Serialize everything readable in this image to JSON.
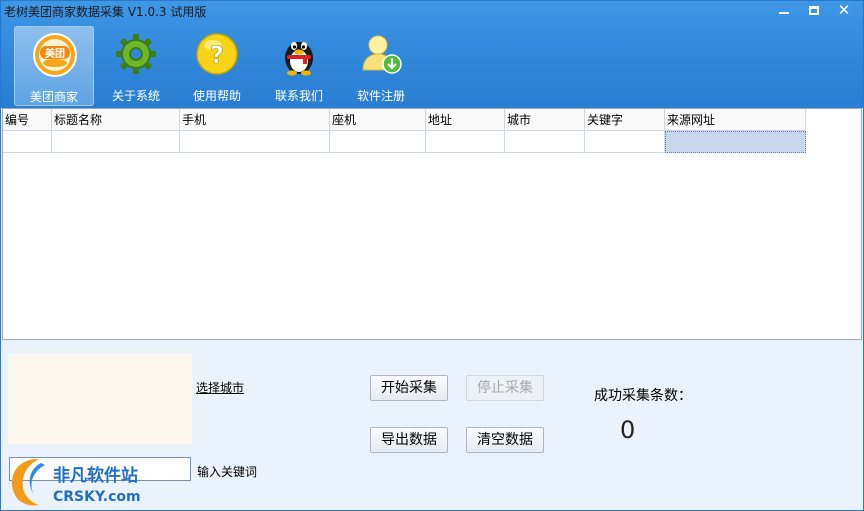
{
  "app": {
    "title": "老树美团商家数据采集 V1.0.3 试用版"
  },
  "window_controls": {
    "minimize": "minimize",
    "maximize": "maximize",
    "close": "close"
  },
  "toolbar": [
    {
      "label": "美团商家",
      "icon": "meituan-logo-icon",
      "badge": "美团"
    },
    {
      "label": "关于系统",
      "icon": "gear-icon"
    },
    {
      "label": "使用帮助",
      "icon": "help-icon",
      "glyph": "?"
    },
    {
      "label": "联系我们",
      "icon": "qq-penguin-icon"
    },
    {
      "label": "软件注册",
      "icon": "user-register-icon"
    }
  ],
  "table": {
    "columns": [
      "编号",
      "标题名称",
      "手机",
      "座机",
      "地址",
      "城市",
      "关键字",
      "来源网址"
    ],
    "rows": [
      [
        "",
        "",
        "",
        "",
        "",
        "",
        "",
        ""
      ]
    ]
  },
  "bottom": {
    "select_city": "选择城市",
    "keyword_value": "",
    "keyword_label": "输入关键词",
    "start_button": "开始采集",
    "stop_button": "停止采集",
    "export_button": "导出数据",
    "clear_button": "清空数据",
    "count_label": "成功采集条数：",
    "count_value": "0"
  },
  "watermark": {
    "text": "非凡软件站",
    "sub": "CRSKY.com"
  },
  "colors": {
    "titlebar": "#3f97e6",
    "panel": "#eaf2fb",
    "selected_cell": "#c8d6ee"
  }
}
